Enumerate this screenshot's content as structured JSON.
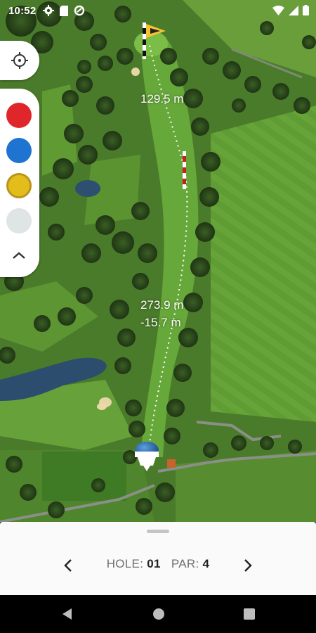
{
  "status_bar": {
    "time": "10:52",
    "icons": [
      "gear-icon",
      "sd-card-icon",
      "data-saver-icon",
      "wifi-icon",
      "signal-icon",
      "battery-icon"
    ]
  },
  "map": {
    "distance_to_flag": "129.5 m",
    "distance_from_tee": "273.9 m",
    "elevation_delta": "-15.7 m",
    "colors": {
      "fairway": "#5e9a32",
      "rough": "#4c7e2a",
      "trees": "#2c4a1c",
      "water": "#2c4d6e",
      "sand": "#e6d6a4"
    }
  },
  "tools": {
    "locate_icon": "crosshair-icon",
    "swatches": [
      {
        "name": "red",
        "color": "#e0262a"
      },
      {
        "name": "blue",
        "color": "#1f74d1"
      },
      {
        "name": "yellow",
        "color": "#e3bd1c"
      },
      {
        "name": "gray",
        "color": "#dfe4e4"
      }
    ],
    "collapse_icon": "chevron-up-icon"
  },
  "bottom_sheet": {
    "hole_label": "HOLE:",
    "hole_value": "01",
    "par_label": "PAR:",
    "par_value": "4"
  },
  "nav_bar": {
    "buttons": [
      "back-icon",
      "home-icon",
      "recents-icon"
    ]
  }
}
